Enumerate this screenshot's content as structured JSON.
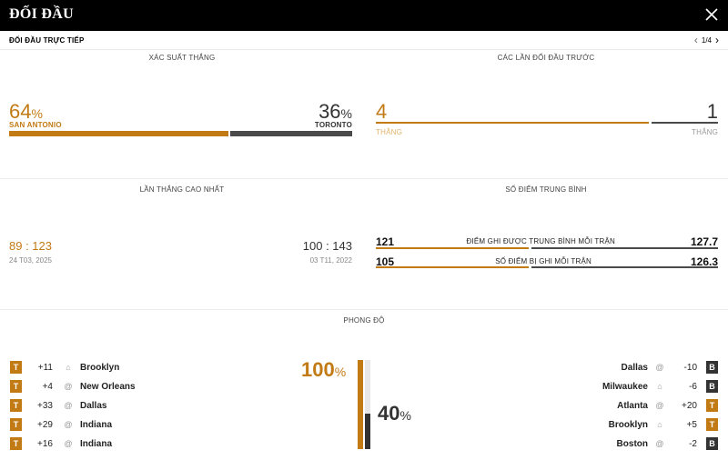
{
  "header": {
    "title": "ĐỐI ĐẦU"
  },
  "subheader": {
    "title": "ĐỐI ĐẦU TRỰC TIẾP",
    "pager": "1/4"
  },
  "colors": {
    "team_a": "#c27a14",
    "team_b": "#4a4a4a",
    "topbar": "#000000"
  },
  "win_prob": {
    "title": "XÁC SUẤT THẮNG",
    "team_a": {
      "name": "SAN ANTONIO",
      "value": "64",
      "pct": "%",
      "fraction": 0.64
    },
    "team_b": {
      "name": "TORONTO",
      "value": "36",
      "pct": "%",
      "fraction": 0.36
    }
  },
  "previous": {
    "title": "CÁC LẦN ĐỐI ĐẦU TRƯỚC",
    "team_a": {
      "wins": "4",
      "label": "THẮNG"
    },
    "team_b": {
      "wins": "1",
      "label": "THẮNG"
    }
  },
  "biggest_win": {
    "title": "LẦN THẮNG CAO NHẤT",
    "team_a": {
      "score": "89 : 123",
      "date": "24 T03, 2025"
    },
    "team_b": {
      "score": "100 : 143",
      "date": "03 T11, 2022"
    }
  },
  "avg_points": {
    "title": "SỐ ĐIỂM TRUNG BÌNH",
    "rows": [
      {
        "a": "121",
        "label": "ĐIỂM GHI ĐƯỢC TRUNG BÌNH MỖI TRẬN",
        "b": "127.7",
        "a_share": 0.487
      },
      {
        "a": "105",
        "label": "SỐ ĐIỂM BỊ GHI MỖI TRẬN",
        "b": "126.3",
        "a_share": 0.454
      }
    ]
  },
  "form": {
    "title": "PHONG ĐỘ",
    "team_a": {
      "pct": "100",
      "pct_sign": "%",
      "fraction": 1.0,
      "games": [
        {
          "result": "T",
          "diff": "+11",
          "venue_icon": "home-icon",
          "venue": "⌂",
          "opponent": "Brooklyn"
        },
        {
          "result": "T",
          "diff": "+4",
          "venue_icon": "away-icon",
          "venue": "@",
          "opponent": "New Orleans"
        },
        {
          "result": "T",
          "diff": "+33",
          "venue_icon": "away-icon",
          "venue": "@",
          "opponent": "Dallas"
        },
        {
          "result": "T",
          "diff": "+29",
          "venue_icon": "away-icon",
          "venue": "@",
          "opponent": "Indiana"
        },
        {
          "result": "T",
          "diff": "+16",
          "venue_icon": "away-icon",
          "venue": "@",
          "opponent": "Indiana"
        }
      ]
    },
    "team_b": {
      "pct": "40",
      "pct_sign": "%",
      "fraction": 0.4,
      "games": [
        {
          "result": "B",
          "diff": "-10",
          "venue_icon": "away-icon",
          "venue": "@",
          "opponent": "Dallas"
        },
        {
          "result": "B",
          "diff": "-6",
          "venue_icon": "home-icon",
          "venue": "⌂",
          "opponent": "Milwaukee"
        },
        {
          "result": "T",
          "diff": "+20",
          "venue_icon": "away-icon",
          "venue": "@",
          "opponent": "Atlanta"
        },
        {
          "result": "T",
          "diff": "+5",
          "venue_icon": "home-icon",
          "venue": "⌂",
          "opponent": "Brooklyn"
        },
        {
          "result": "B",
          "diff": "-2",
          "venue_icon": "away-icon",
          "venue": "@",
          "opponent": "Boston"
        }
      ]
    }
  }
}
